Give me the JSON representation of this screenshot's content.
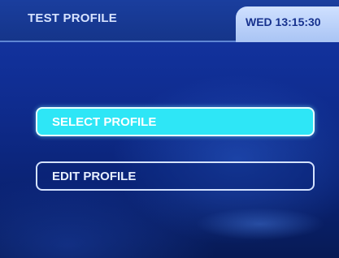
{
  "header": {
    "title": "TEST PROFILE",
    "clock": "WED 13:15:30"
  },
  "menu": {
    "items": [
      {
        "label": "SELECT PROFILE",
        "state": "selected"
      },
      {
        "label": "EDIT PROFILE",
        "state": "normal"
      }
    ]
  },
  "colors": {
    "background": "#1436a6",
    "selected_button": "#2ee6f6",
    "button_border": "#d4e2ff",
    "clock_tab": "#cfe0ff"
  }
}
